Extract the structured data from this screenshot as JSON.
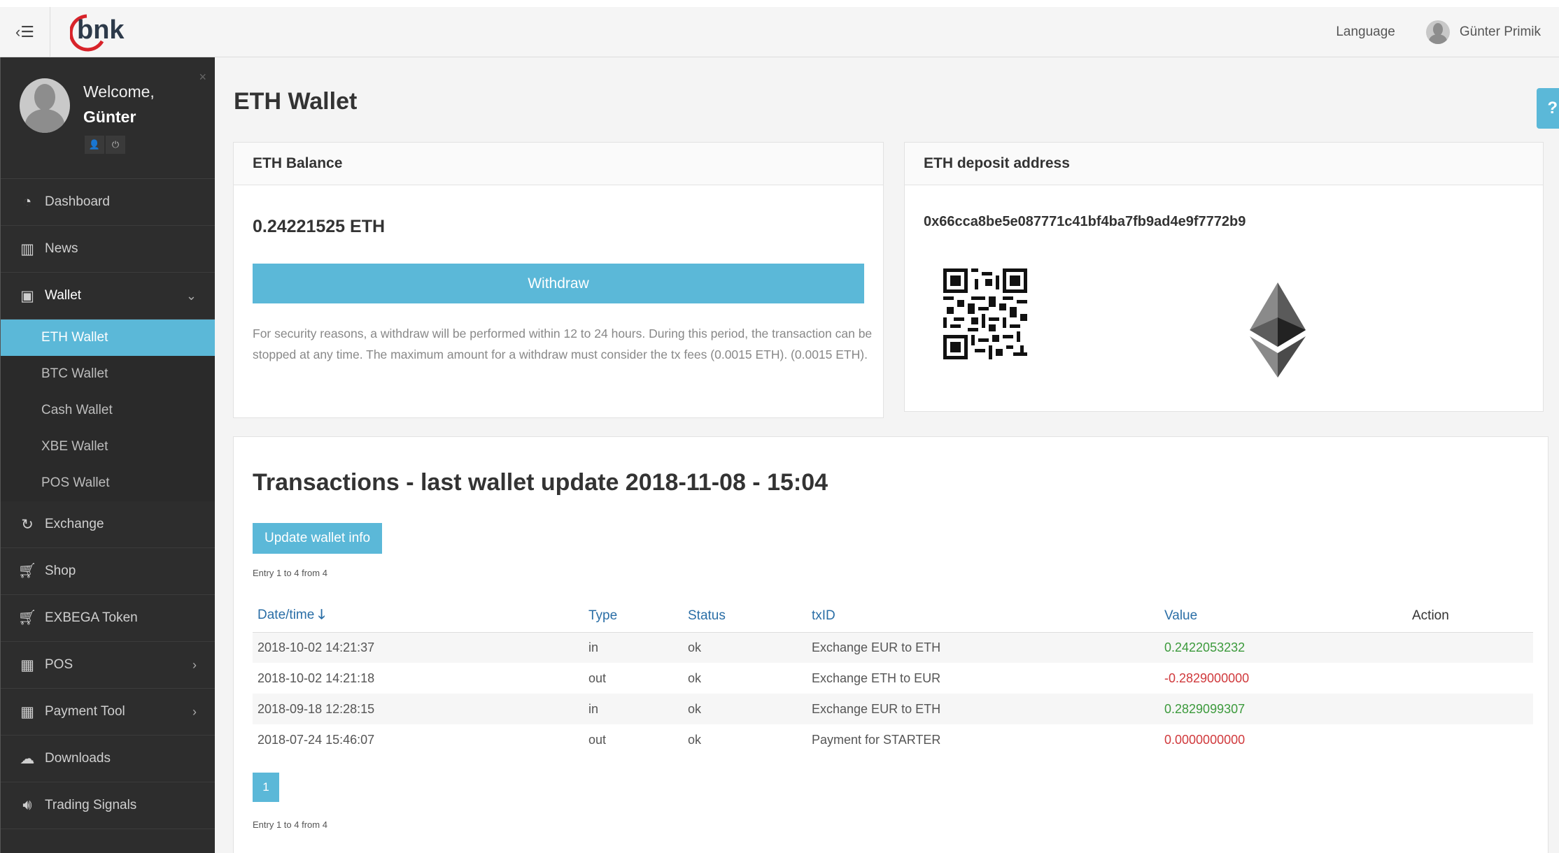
{
  "topbar": {
    "menu_icon": "menu-toggle-icon",
    "language_label": "Language",
    "user_name": "Günter Primik"
  },
  "sidebar": {
    "welcome": "Welcome,",
    "user_first_name": "Günter",
    "items": [
      {
        "label": "Dashboard",
        "icon": "dashboard-icon"
      },
      {
        "label": "News",
        "icon": "book-icon"
      },
      {
        "label": "Wallet",
        "icon": "money-icon"
      },
      {
        "label": "Exchange",
        "icon": "refresh-icon"
      },
      {
        "label": "Shop",
        "icon": "cart-icon"
      },
      {
        "label": "EXBEGA Token",
        "icon": "cart-icon"
      },
      {
        "label": "POS",
        "icon": "calculator-icon"
      },
      {
        "label": "Payment Tool",
        "icon": "calculator-icon"
      },
      {
        "label": "Downloads",
        "icon": "cloud-download-icon"
      },
      {
        "label": "Trading Signals",
        "icon": "volume-icon"
      }
    ],
    "wallet_sub": [
      "ETH Wallet",
      "BTC Wallet",
      "Cash Wallet",
      "XBE Wallet",
      "POS Wallet"
    ]
  },
  "page": {
    "title": "ETH Wallet",
    "help": "?"
  },
  "balance": {
    "heading": "ETH Balance",
    "value": "0.24221525 ETH",
    "withdraw_label": "Withdraw",
    "note": "For security reasons, a withdraw will be performed within 12 to 24 hours. During this period, the transaction can be stopped at any time. The maximum amount for a withdraw must consider the tx fees (0.0015 ETH). (0.0015 ETH)."
  },
  "deposit": {
    "heading": "ETH deposit address",
    "address": "0x66cca8be5e087771c41bf4ba7fb9ad4e9f7772b9"
  },
  "transactions": {
    "title": "Transactions - last wallet update 2018-11-08 - 15:04",
    "update_label": "Update wallet info",
    "entry_info": "Entry 1 to 4 from 4",
    "columns": {
      "date": "Date/time",
      "type": "Type",
      "status": "Status",
      "txid": "txID",
      "value": "Value",
      "action": "Action"
    },
    "rows": [
      {
        "date": "2018-10-02 14:21:37",
        "type": "in",
        "status": "ok",
        "txid": "Exchange EUR to ETH",
        "value": "0.2422053232"
      },
      {
        "date": "2018-10-02 14:21:18",
        "type": "out",
        "status": "ok",
        "txid": "Exchange ETH to EUR",
        "value": "-0.2829000000"
      },
      {
        "date": "2018-09-18 12:28:15",
        "type": "in",
        "status": "ok",
        "txid": "Exchange EUR to ETH",
        "value": "0.2829099307"
      },
      {
        "date": "2018-07-24 15:46:07",
        "type": "out",
        "status": "ok",
        "txid": "Payment for STARTER",
        "value": "0.0000000000"
      }
    ],
    "page_number": "1"
  },
  "colors": {
    "accent": "#5bb8d8",
    "sidebar": "#2d2d2d",
    "positive": "#3c9a3c",
    "negative": "#d0393c"
  }
}
